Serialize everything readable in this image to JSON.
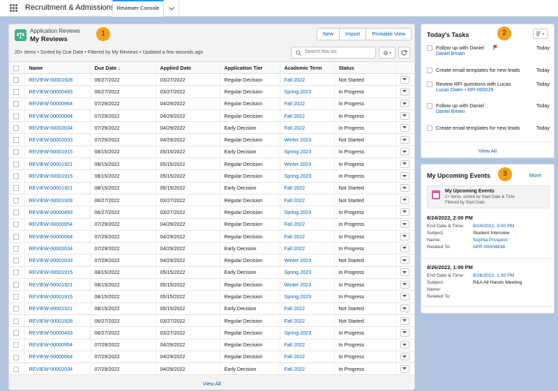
{
  "app": {
    "title": "Recruitment & Admissions",
    "tab": "Reviewer Console"
  },
  "reviews": {
    "kicker": "Application Reviews",
    "title": "My Reviews",
    "marker": "1",
    "buttons": [
      "New",
      "Import",
      "Printable View"
    ],
    "meta": "20+ items • Sorted by Due Date • Filtered by My Reviews • Updated a few seconds ago",
    "search_placeholder": "Search this list",
    "columns": [
      "Name",
      "Due Date ↓",
      "Applied Date",
      "Application Tier",
      "Academic Term",
      "Status"
    ],
    "rows": [
      [
        "REVIEW-00001928",
        "06/27/2022",
        "03/27/2022",
        "Regular Decision",
        "Fall 2022",
        "Not Started"
      ],
      [
        "REVIEW-00000493",
        "06/27/2022",
        "03/27/2022",
        "Regular Decision",
        "Spring 2023",
        "In Progress"
      ],
      [
        "REVIEW-00000954",
        "07/29/2022",
        "04/29/2022",
        "Regular Decision",
        "Fall 2022",
        "In Progress"
      ],
      [
        "REVIEW-00000064",
        "07/29/2022",
        "04/29/2022",
        "Regular Decision",
        "Fall 2022",
        "In Progress"
      ],
      [
        "REVIEW-00002034",
        "07/29/2022",
        "04/29/2022",
        "Early Decision",
        "Fall 2022",
        "In Progress"
      ],
      [
        "REVIEW-00002033",
        "07/29/2022",
        "04/29/2022",
        "Regular Decision",
        "Winter 2023",
        "Not Started"
      ],
      [
        "REVIEW-00001915",
        "08/15/2022",
        "05/15/2022",
        "Early Decision",
        "Spring 2023",
        "In Progress"
      ],
      [
        "REVIEW-00001921",
        "08/15/2022",
        "05/15/2022",
        "Regular Decision",
        "Winter 2023",
        "In Progress"
      ],
      [
        "REVIEW-00001915",
        "08/15/2022",
        "05/15/2022",
        "Regular Decision",
        "Spring 2023",
        "In Progress"
      ],
      [
        "REVIEW-00001921",
        "08/15/2022",
        "05/15/2022",
        "Early Decision",
        "Fall 2022",
        "Not Started"
      ],
      [
        "REVIEW-00001928",
        "06/27/2022",
        "03/27/2022",
        "Regular Decision",
        "Fall 2022",
        "Not Started"
      ],
      [
        "REVIEW-00000493",
        "06/27/2022",
        "03/27/2022",
        "Regular Decision",
        "Spring 2023",
        "In Progress"
      ],
      [
        "REVIEW-00000954",
        "07/29/2022",
        "04/29/2022",
        "Regular Decision",
        "Fall 2022",
        "In Progress"
      ],
      [
        "REVIEW-00000064",
        "07/29/2022",
        "04/29/2022",
        "Regular Decision",
        "Fall 2022",
        "In Progress"
      ],
      [
        "REVIEW-00002034",
        "07/29/2022",
        "04/29/2022",
        "Early Decision",
        "Fall 2022",
        "In Progress"
      ],
      [
        "REVIEW-00002033",
        "07/29/2022",
        "04/29/2022",
        "Regular Decision",
        "Winter 2023",
        "Not Started"
      ],
      [
        "REVIEW-00001915",
        "08/15/2022",
        "05/15/2022",
        "Early Decision",
        "Spring 2023",
        "In Progress"
      ],
      [
        "REVIEW-00001921",
        "08/15/2022",
        "05/15/2022",
        "Regular Decision",
        "Winter 2023",
        "In Progress"
      ],
      [
        "REVIEW-00001915",
        "08/15/2022",
        "05/15/2022",
        "Regular Decision",
        "Spring 2023",
        "In Progress"
      ],
      [
        "REVIEW-00001921",
        "08/15/2022",
        "05/15/2022",
        "Early Decision",
        "Fall 2022",
        "Not Started"
      ],
      [
        "REVIEW-00001928",
        "06/27/2022",
        "03/27/2022",
        "Regular Decision",
        "Fall 2022",
        "Not Started"
      ],
      [
        "REVIEW-00000493",
        "06/27/2022",
        "03/27/2022",
        "Regular Decision",
        "Spring 2023",
        "In Progress"
      ],
      [
        "REVIEW-00000954",
        "07/29/2022",
        "04/29/2022",
        "Regular Decision",
        "Fall 2022",
        "In Progress"
      ],
      [
        "REVIEW-00000064",
        "07/29/2022",
        "04/29/2022",
        "Regular Decision",
        "Fall 2022",
        "In Progress"
      ],
      [
        "REVIEW-00002034",
        "07/29/2022",
        "04/29/2022",
        "Early Decision",
        "Fall 2022",
        "In Progress"
      ]
    ],
    "view_all": "View All"
  },
  "tasks": {
    "title": "Today's Tasks",
    "marker": "2",
    "items": [
      {
        "title": "Follow up with Daniel",
        "sub": "Daniel Brown",
        "sub2": "",
        "date": "Today",
        "flag": true
      },
      {
        "title": "Create email templates for new leads",
        "sub": "",
        "sub2": "",
        "date": "Today",
        "flag": false
      },
      {
        "title": "Review RFI questions with Lucas",
        "sub": "Lucas Owen",
        "sub2": "RFI-000029",
        "date": "Today",
        "flag": false
      },
      {
        "title": "Follow up with Daniel",
        "sub": "Daniel Brown",
        "sub2": "",
        "date": "Today",
        "flag": false
      },
      {
        "title": "Create email templates for new leads",
        "sub": "",
        "sub2": "",
        "date": "Today",
        "flag": false
      }
    ],
    "view_all": "View All"
  },
  "events": {
    "title": "My Upcoming Events",
    "marker": "3",
    "more": "More",
    "list_title": "My Upcoming Events",
    "list_meta1": "2+ items, sorted by Start Date & Time",
    "list_meta2": "Filtered by Start Date",
    "items": [
      {
        "start": "8/24/2022, 2:00 PM",
        "end_label": "End Date & Time:",
        "end": "8/24/2022, 3:00 PM",
        "subject_label": "Subject:",
        "subject": "Student Interview",
        "name_label": "Name:",
        "name": "Sophia Prospect",
        "related_label": "Related To:",
        "related": "APP-00004838"
      },
      {
        "start": "8/26/2022, 1:00 PM",
        "end_label": "End Date & Time:",
        "end": "8/26/2022, 1:30 PM",
        "subject_label": "Subject:",
        "subject": "R&A All Hands Meeting",
        "name_label": "Name:",
        "name": "",
        "related_label": "Related To:",
        "related": ""
      }
    ]
  },
  "colors": {
    "link": "#0b5cab",
    "marker": "#f3a21c",
    "background": "#b0c4df",
    "icon_green": "#3bb28a",
    "calendar_pink": "#e3579c"
  }
}
